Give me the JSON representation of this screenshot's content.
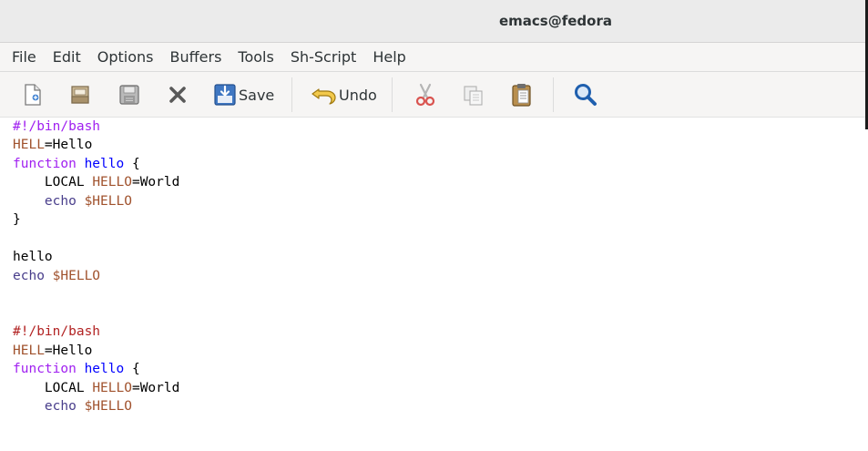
{
  "window": {
    "title": "emacs@fedora"
  },
  "menu": [
    "File",
    "Edit",
    "Options",
    "Buffers",
    "Tools",
    "Sh-Script",
    "Help"
  ],
  "toolbar": {
    "new_file_icon": "new-file-icon",
    "open_icon": "folder-open-icon",
    "save_icon": "save-disk-icon",
    "close_icon": "close-x-icon",
    "save_label": "Save",
    "undo_label": "Undo",
    "cut_icon": "scissors-icon",
    "copy_icon": "copy-icon",
    "paste_icon": "paste-clipboard-icon",
    "search_icon": "magnifier-icon"
  },
  "colors": {
    "comment": "#b22222",
    "shebang_first": "#a020f0",
    "variable": "#a0522d",
    "keyword": "#a020f0",
    "function_name": "#0000ff",
    "builtin": "#483d8b"
  },
  "buffer": {
    "l1": "#!/bin/bash",
    "l2_var": "HELL",
    "l2_rest": "=Hello",
    "l3_kw": "function",
    "l3_fn": "hello",
    "l3_rest": " {",
    "l4_pre": "    LOCAL ",
    "l4_var": "HELLO",
    "l4_rest": "=World",
    "l5_builtin": "    echo",
    "l5_var": "$HELLO",
    "l6": "}",
    "l8": "hello",
    "l9_builtin": "echo",
    "l9_var": "$HELLO",
    "l12": "#!/bin/bash",
    "l13_var": "HELL",
    "l13_rest": "=Hello",
    "l14_kw": "function",
    "l14_fn": "hello",
    "l14_rest": " {",
    "l15_pre": "    LOCAL ",
    "l15_var": "HELLO",
    "l15_rest": "=World",
    "l16_builtin": "    echo",
    "l16_var": "$HELLO"
  }
}
